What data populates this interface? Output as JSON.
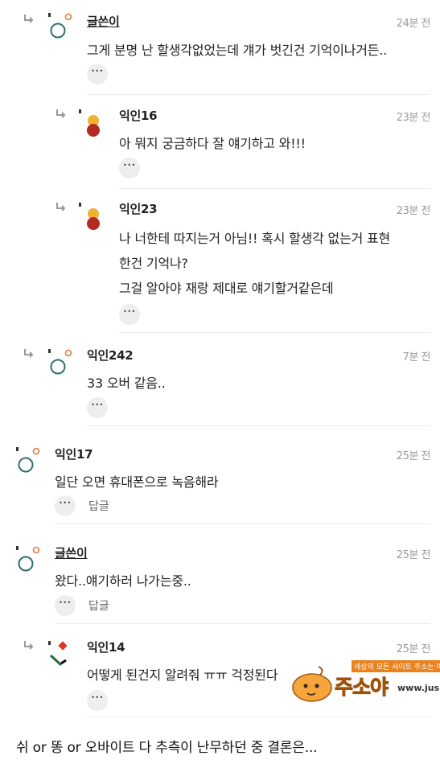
{
  "comments": [
    {
      "author": "글쓴이",
      "time": "24분 전",
      "lines": [
        "그게 분명 난 할생각없었는데 걔가 벗긴건 기억이나거든.."
      ],
      "reply_label": ""
    },
    {
      "author": "익인16",
      "time": "23분 전",
      "lines": [
        "아 뭐지 궁금하다 잘 얘기하고 와!!!"
      ],
      "reply_label": ""
    },
    {
      "author": "익인23",
      "time": "23분 전",
      "lines": [
        "나 너한테 따지는거 아님!! 혹시 할생각 없는거 표현",
        "한건 기억나?",
        "그걸 알아야 재랑 제대로 얘기할거같은데"
      ],
      "reply_label": ""
    },
    {
      "author": "익인242",
      "time": "7분 전",
      "lines": [
        "33 오버 같음.."
      ],
      "reply_label": ""
    },
    {
      "author": "익인17",
      "time": "25분 전",
      "lines": [
        "일단 오면 휴대폰으로 녹음해라"
      ],
      "reply_label": "답글"
    },
    {
      "author": "글쓴이",
      "time": "25분 전",
      "lines": [
        "왔다..얘기하러 나가는중.."
      ],
      "reply_label": "답글"
    },
    {
      "author": "익인14",
      "time": "25분 전",
      "lines": [
        "어떻게 된건지 알려줘 ㅠㅠ 걱정된다"
      ],
      "reply_label": ""
    }
  ],
  "footer_text": "쉬 or 똥 or 오바이트 다 추측이 난무하던 중 결론은...",
  "watermark": {
    "tagline": "세상의 모든 사이트 주소는 여기",
    "brand": "주소야",
    "url": "www.jus"
  },
  "colors": {
    "avatar_orange": "#e07a3c",
    "avatar_teal": "#2f6f6a",
    "avatar_yellow": "#f2b132",
    "avatar_red": "#b22a22",
    "brand_orange": "#f29a2e"
  }
}
